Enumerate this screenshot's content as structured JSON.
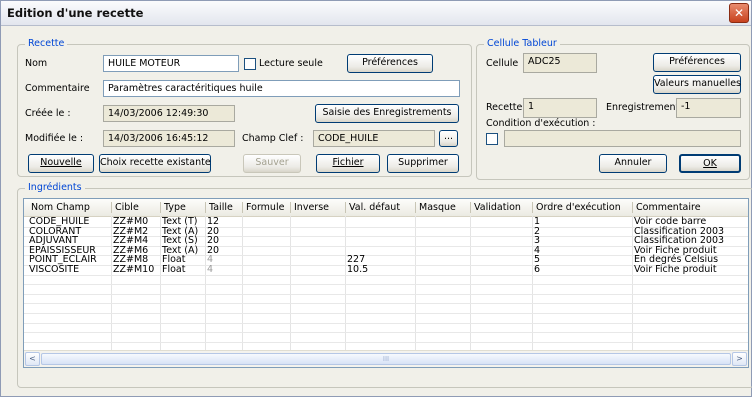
{
  "window": {
    "title": "Edition d'une recette"
  },
  "recette": {
    "legend": "Recette",
    "nom_label": "Nom",
    "nom_value": "HUILE MOTEUR",
    "lecture_seule_label": "Lecture seule",
    "lecture_seule_checked": false,
    "preferences_label": "Préférences",
    "commentaire_label": "Commentaire",
    "commentaire_value": "Paramètres caractéritiques huile",
    "creee_label": "Créée le :",
    "creee_value": "14/03/2006 12:49:30",
    "saisie_label": "Saisie des Enregistrements",
    "modifiee_label": "Modifiée le :",
    "modifiee_value": "14/03/2006 16:45:12",
    "champ_clef_label": "Champ Clef :",
    "champ_clef_value": "CODE_HUILE",
    "ellipsis_label": "...",
    "nouvelle_label": "Nouvelle",
    "choix_label": "Choix recette existante",
    "sauver_label": "Sauver",
    "fichier_label": "Fichier",
    "supprimer_label": "Supprimer"
  },
  "cellule": {
    "legend": "Cellule Tableur",
    "cellule_label": "Cellule",
    "cellule_value": "ADC25",
    "preferences_label": "Préférences",
    "valeurs_label": "Valeurs manuelles",
    "recette_label": "Recette",
    "recette_value": "1",
    "enregistrement_label": "Enregistrement",
    "enregistrement_value": "-1",
    "condition_label": "Condition d'exécution :",
    "condition_checked": false,
    "condition_value": "",
    "annuler_label": "Annuler",
    "ok_label": "OK"
  },
  "ingredients": {
    "legend": "Ingrédients",
    "columns": [
      "Nom Champ",
      "Cible",
      "Type",
      "Taille",
      "Formule",
      "Inverse",
      "Val. défaut",
      "Masque",
      "Validation",
      "Ordre d'exécution",
      "Commentaire"
    ],
    "rows": [
      [
        "CODE_HUILE",
        "ZZ#M0",
        "Text (T)",
        "12",
        "",
        "",
        "",
        "",
        "",
        "1",
        "Voir code barre"
      ],
      [
        "COLORANT",
        "ZZ#M2",
        "Text (A)",
        "20",
        "",
        "",
        "",
        "",
        "",
        "2",
        "Classification 2003"
      ],
      [
        "ADJUVANT",
        "ZZ#M4",
        "Text (S)",
        "20",
        "",
        "",
        "",
        "",
        "",
        "3",
        "Classification 2003"
      ],
      [
        "EPAISSISSEUR",
        "ZZ#M6",
        "Text (A)",
        "20",
        "",
        "",
        "",
        "",
        "",
        "4",
        "Voir Fiche produit"
      ],
      [
        "POINT_ECLAIR",
        "ZZ#M8",
        "Float",
        "4",
        "",
        "",
        "227",
        "",
        "",
        "5",
        "En degrés Celsius"
      ],
      [
        "VISCOSITE",
        "ZZ#M10",
        "Float",
        "4",
        "",
        "",
        "10.5",
        "",
        "",
        "6",
        "Voir Fiche produit"
      ]
    ],
    "empty_rows": 8,
    "scroll_left": "<",
    "scroll_right": ">",
    "scroll_thumb": "III"
  }
}
